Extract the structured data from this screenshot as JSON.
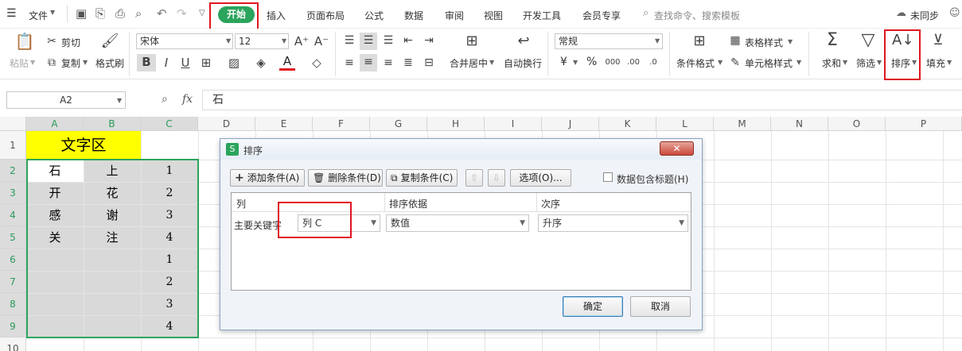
{
  "menubar": {
    "file": "文件",
    "tabs": [
      "开始",
      "插入",
      "页面布局",
      "公式",
      "数据",
      "审阅",
      "视图",
      "开发工具",
      "会员专享"
    ],
    "search": "查找命令、搜索模板",
    "sync": "未同步"
  },
  "ribbon": {
    "paste": "粘贴",
    "cut": "剪切",
    "copy": "复制",
    "format_painter": "格式刷",
    "font_name": "宋体",
    "font_size": "12",
    "merge_center": "合并居中",
    "wrap_text": "自动换行",
    "number_format": "常规",
    "currency": "¥",
    "percent": "%",
    "conditional_format": "条件格式",
    "table_style": "表格样式",
    "cell_style": "单元格样式",
    "sum": "求和",
    "filter": "筛选",
    "sort": "排序",
    "fill": "填充"
  },
  "formula_bar": {
    "name_box": "A2",
    "fx": "fx",
    "content": "石"
  },
  "sheet": {
    "columns": [
      "A",
      "B",
      "C",
      "D",
      "E",
      "F",
      "G",
      "H",
      "I",
      "J",
      "K",
      "L",
      "M",
      "N",
      "O",
      "P"
    ],
    "rows": [
      "1",
      "2",
      "3",
      "4",
      "5",
      "6",
      "7",
      "8",
      "9",
      "10"
    ],
    "header_text": "文字区",
    "colA": [
      "石",
      "开",
      "感",
      "关"
    ],
    "colB": [
      "上",
      "花",
      "谢",
      "注"
    ],
    "colC": [
      "1",
      "2",
      "3",
      "4",
      "1",
      "2",
      "3",
      "4"
    ]
  },
  "sort_dialog": {
    "title": "排序",
    "add_condition": "添加条件(A)",
    "delete_condition": "删除条件(D)",
    "copy_condition": "复制条件(C)",
    "options": "选项(O)...",
    "has_header": "数据包含标题(H)",
    "col_header": "列",
    "basis_header": "排序依据",
    "order_header": "次序",
    "primary_key": "主要关键字",
    "column_value": "列 C",
    "basis_value": "数值",
    "order_value": "升序",
    "ok": "确定",
    "cancel": "取消"
  },
  "colors": {
    "accent_green": "#2ba45c",
    "highlight_red": "#e0161e",
    "header_yellow": "#ffff00"
  }
}
